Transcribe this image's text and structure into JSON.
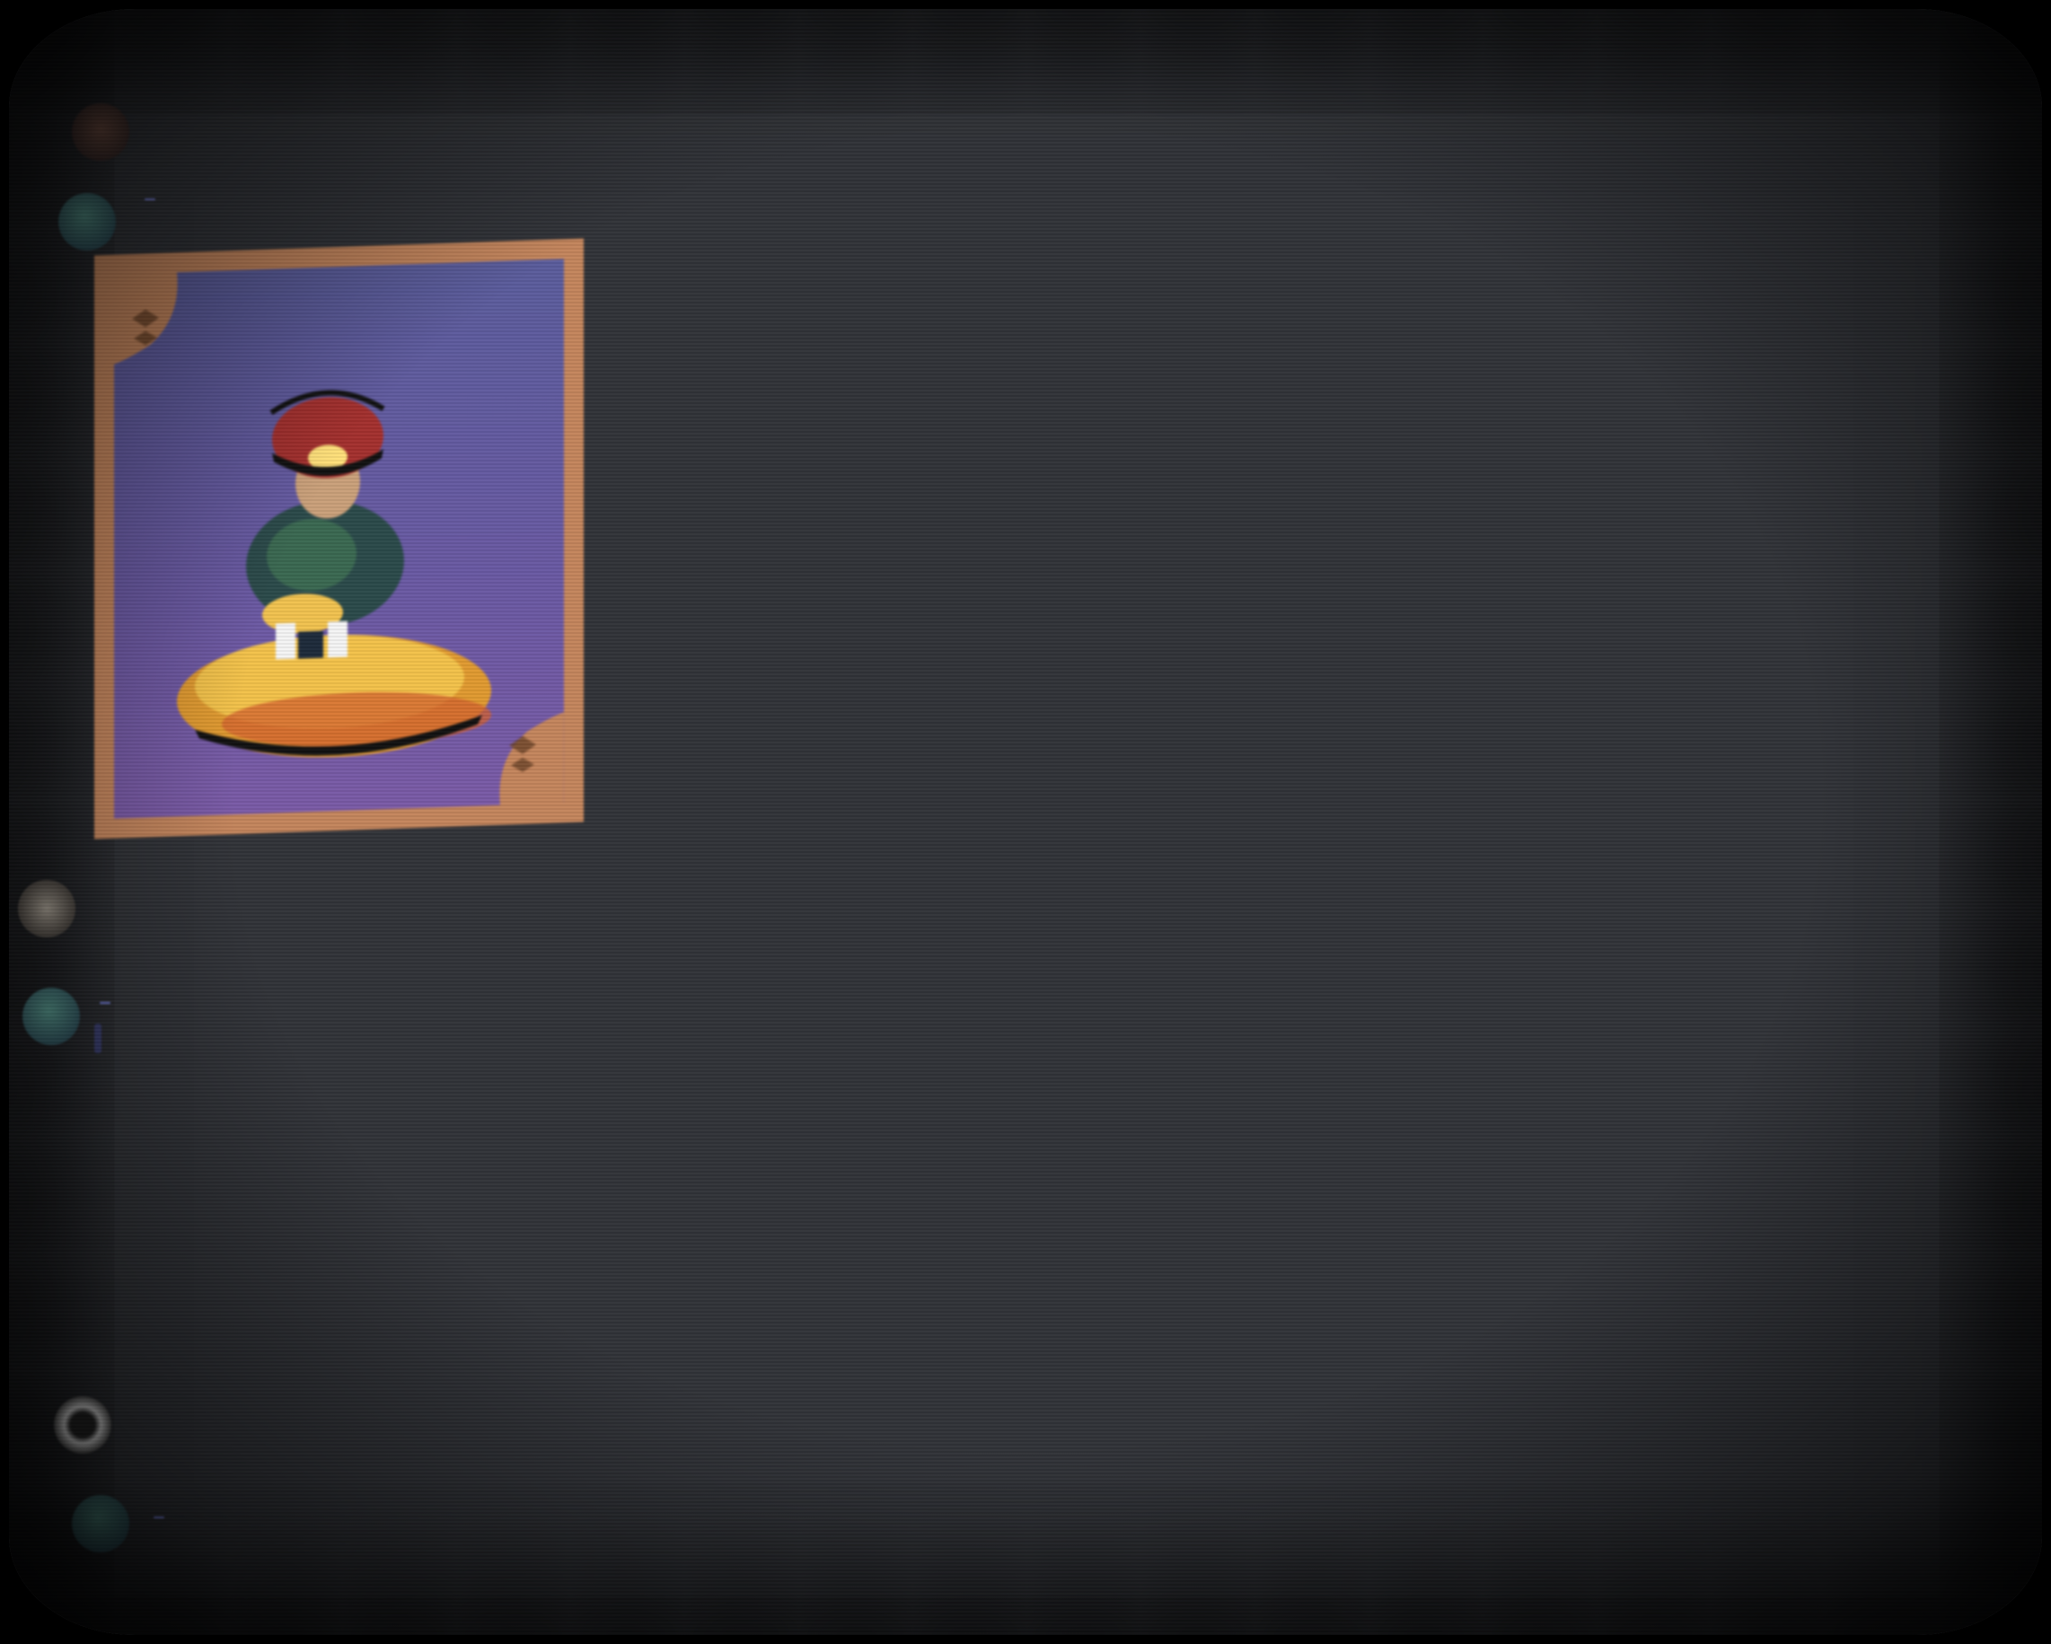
{
  "messages": [
    {
      "id": "m1",
      "username": "",
      "tag": "",
      "timestamp": "",
      "lines": [
        ""
      ]
    },
    {
      "id": "m2",
      "username": "",
      "tag": "",
      "timestamp": "",
      "lines": [
        "",
        ""
      ],
      "mention": "",
      "image": {
        "alt": ""
      }
    },
    {
      "id": "m3",
      "username": "",
      "tag": "",
      "timestamp": "",
      "lines": [
        ""
      ]
    },
    {
      "id": "m4",
      "username": "",
      "tag": "",
      "timestamp": "",
      "mention": "",
      "lines": [
        "",
        "",
        "",
        "",
        "",
        "",
        "",
        "",
        ""
      ]
    },
    {
      "id": "m5",
      "username": "",
      "tag": "",
      "timestamp": "",
      "lines": [
        ""
      ]
    },
    {
      "id": "m6",
      "username": "",
      "tag": "",
      "timestamp": "",
      "lines": [
        ""
      ]
    }
  ],
  "colors": {
    "background": "#313338",
    "username_orange": "#c97a3a",
    "username_blue": "#5a6fd0",
    "username_gold": "#d7a73a",
    "tag_bg": "#7b86e6",
    "card_frame": "#c4855c",
    "card_bg": "#5a5c9c"
  },
  "icons": [
    "avatar"
  ]
}
